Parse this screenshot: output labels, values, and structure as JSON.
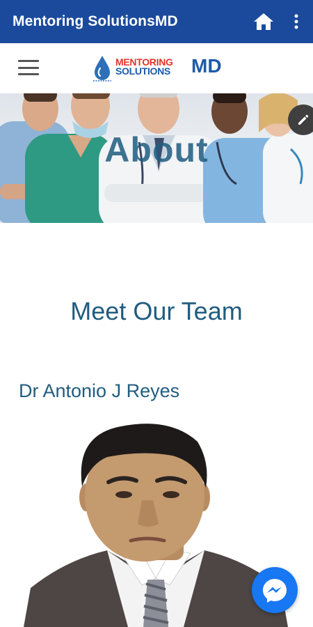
{
  "appbar": {
    "title": "Mentoring SolutionsMD",
    "home_icon": "home-icon",
    "more_icon": "more-vertical-icon"
  },
  "header": {
    "menu_icon": "hamburger-menu-icon",
    "logo": {
      "word1": "MENTORING",
      "word2": "SOLUTIONS",
      "suffix": "MD"
    }
  },
  "hero": {
    "title": "About",
    "edit_icon": "pencil-icon"
  },
  "team": {
    "heading": "Meet Our Team",
    "members": [
      {
        "name": "Dr Antonio J Reyes"
      }
    ]
  },
  "messenger_icon": "messenger-icon",
  "colors": {
    "appbar": "#1b4a9c",
    "heading": "#215c7f",
    "logo_red": "#e2332a",
    "logo_blue": "#1e5aa8",
    "messenger": "#1877f2"
  }
}
